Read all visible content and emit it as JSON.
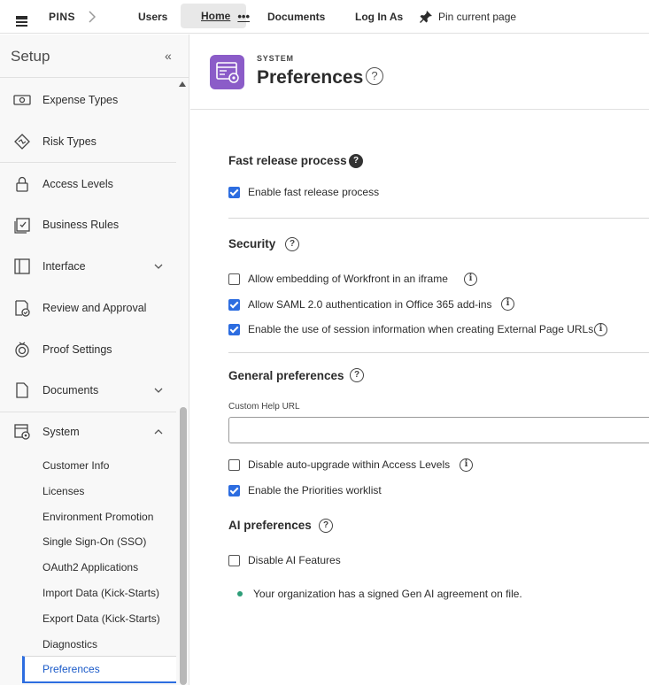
{
  "topbar": {
    "pins": "PINS",
    "tabs": [
      {
        "label": "Users"
      },
      {
        "label": "Home"
      },
      {
        "label": "Documents"
      },
      {
        "label": "Log In As"
      }
    ],
    "more": "•••",
    "pin_label": "Pin current page"
  },
  "sidebar": {
    "title": "Setup",
    "items": [
      {
        "label": "Expense Types",
        "icon": "money-icon"
      },
      {
        "label": "Risk Types",
        "icon": "risk-icon"
      },
      {
        "label": "Access Levels",
        "icon": "lock-icon"
      },
      {
        "label": "Business Rules",
        "icon": "checklist-icon"
      },
      {
        "label": "Interface",
        "icon": "layout-icon"
      },
      {
        "label": "Review and Approval",
        "icon": "document-approval-icon"
      },
      {
        "label": "Proof Settings",
        "icon": "proof-icon"
      },
      {
        "label": "Documents",
        "icon": "document-icon"
      },
      {
        "label": "System",
        "icon": "system-icon"
      }
    ],
    "subitems": [
      {
        "label": "Customer Info"
      },
      {
        "label": "Licenses"
      },
      {
        "label": "Environment Promotion"
      },
      {
        "label": "Single Sign-On (SSO)"
      },
      {
        "label": "OAuth2 Applications"
      },
      {
        "label": "Import Data (Kick-Starts)"
      },
      {
        "label": "Export Data (Kick-Starts)"
      },
      {
        "label": "Diagnostics"
      },
      {
        "label": "Preferences"
      }
    ]
  },
  "main": {
    "kicker": "SYSTEM",
    "title": "Preferences",
    "sections": {
      "fast_release": {
        "title": "Fast release process",
        "options": [
          {
            "label": "Enable fast release process",
            "checked": true
          }
        ]
      },
      "security": {
        "title": "Security",
        "options": [
          {
            "label": "Allow embedding of Workfront in an iframe",
            "checked": false
          },
          {
            "label": "Allow SAML 2.0 authentication in Office 365 add-ins",
            "checked": true
          },
          {
            "label": "Enable the use of session information when creating External Page URLs.",
            "checked": true
          }
        ]
      },
      "general": {
        "title": "General preferences",
        "custom_help_label": "Custom Help URL",
        "custom_help_value": "",
        "options": [
          {
            "label": "Disable auto-upgrade within Access Levels",
            "checked": false
          },
          {
            "label": "Enable the Priorities worklist",
            "checked": true
          }
        ]
      },
      "ai": {
        "title": "AI preferences",
        "options": [
          {
            "label": "Disable AI Features",
            "checked": false
          }
        ],
        "status": "Your organization has a signed Gen AI agreement on file."
      }
    }
  },
  "colors": {
    "accent": "#2d6de0",
    "app_icon": "#8b5cc8",
    "status_dot": "#2d9d78"
  }
}
